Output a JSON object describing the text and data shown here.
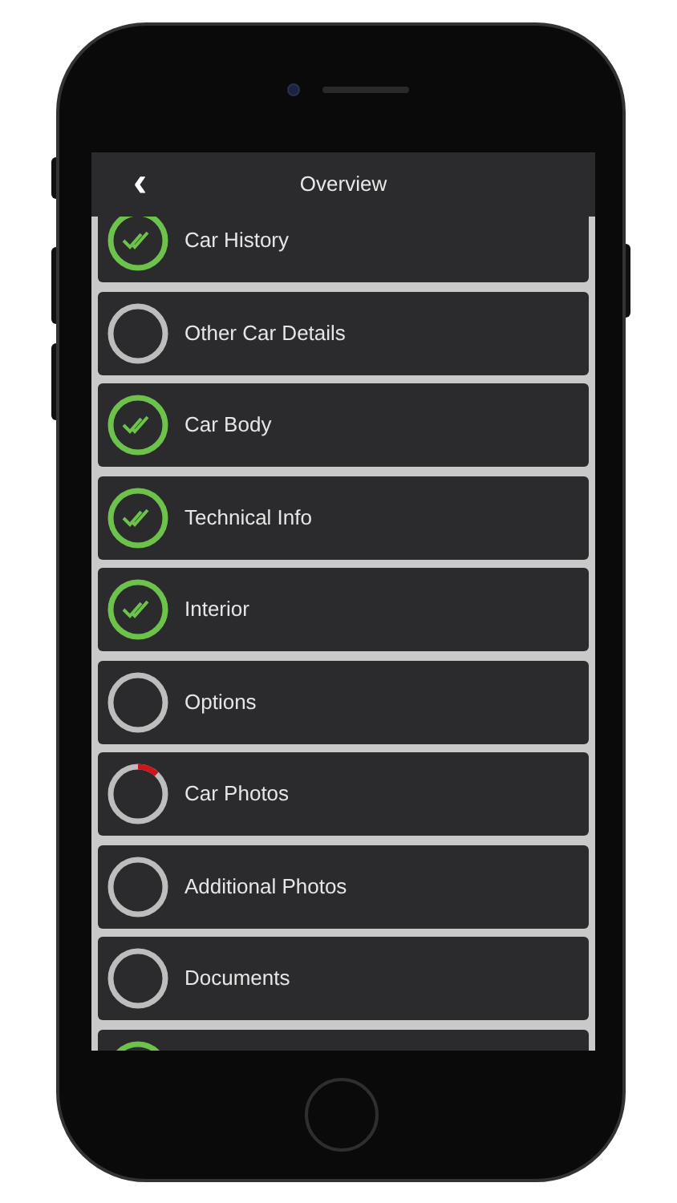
{
  "header": {
    "back_icon": "‹",
    "title": "Overview"
  },
  "sections": [
    {
      "label": "Car History",
      "kind": "complete"
    },
    {
      "label": "Other Car Details",
      "kind": "empty"
    },
    {
      "label": "Car Body",
      "kind": "complete"
    },
    {
      "label": "Technical Info",
      "kind": "complete"
    },
    {
      "label": "Interior",
      "kind": "complete"
    },
    {
      "label": "Options",
      "kind": "empty"
    },
    {
      "label": "Car Photos",
      "kind": "progress",
      "level": 0.12
    },
    {
      "label": "Additional Photos",
      "kind": "empty"
    },
    {
      "label": "Documents",
      "kind": "empty"
    },
    {
      "kind": "complete"
    }
  ]
}
